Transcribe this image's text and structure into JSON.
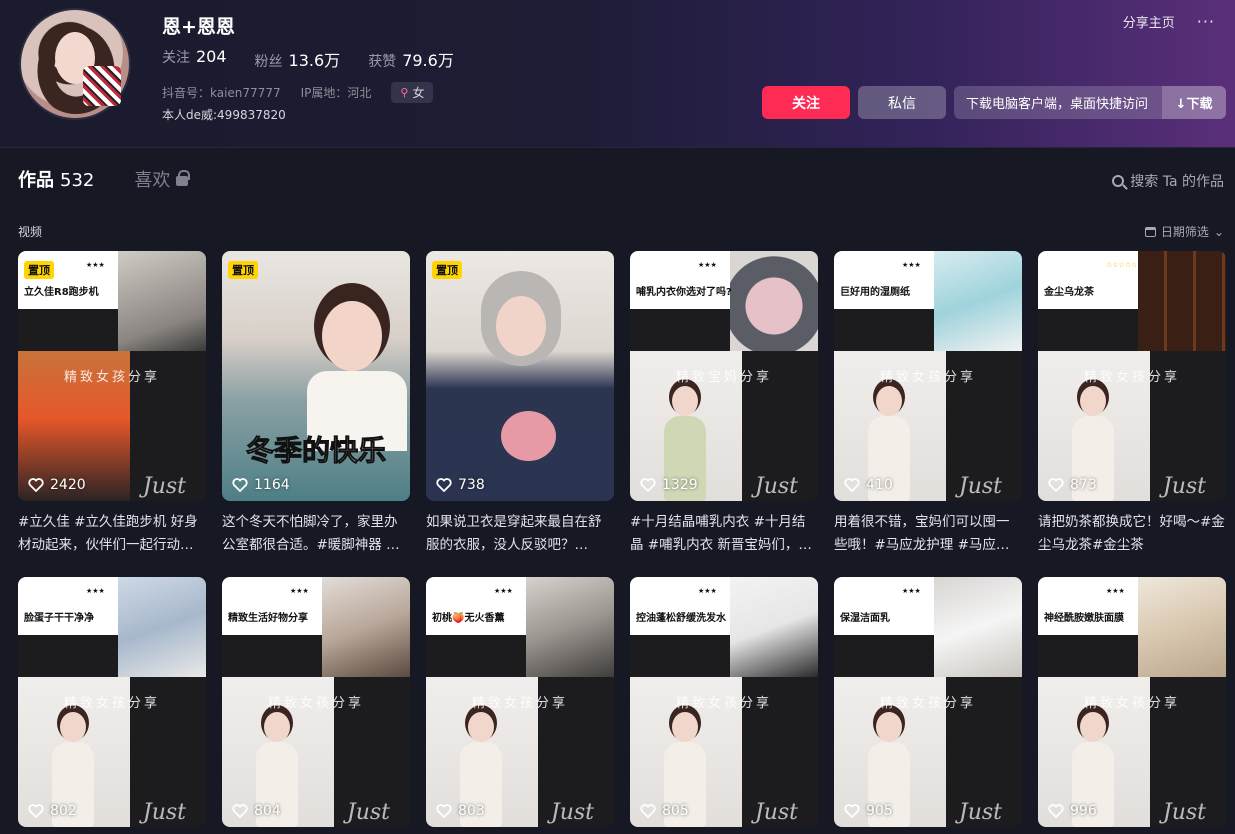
{
  "profile": {
    "name": "恩+恩恩",
    "following_label": "关注",
    "following": "204",
    "followers_label": "粉丝",
    "followers": "13.6万",
    "likes_label": "获赞",
    "likes": "79.6万",
    "douyin_id": "抖音号：kaien77777",
    "ip": "IP属地：河北",
    "gender": "女",
    "bio": "本人de威:499837820"
  },
  "topbar": {
    "share": "分享主页",
    "more": "···"
  },
  "actions": {
    "follow": "关注",
    "message": "私信",
    "download_text": "下载电脑客户端，桌面快捷访问",
    "download_btn": "↓下载"
  },
  "tabs": {
    "works_label": "作品",
    "works_count": "532",
    "likes_label": "喜欢"
  },
  "search": {
    "label": "搜索 Ta 的作品"
  },
  "section": {
    "label": "视频",
    "filter": "日期筛选"
  },
  "colors": {
    "accent": "#fe2c55",
    "bg": "#161823",
    "pin": "#ffd400"
  },
  "videos": [
    {
      "pinned": "置顶",
      "caption": "立久佳R8跑步机",
      "stars": "★★★",
      "watermark": "精致女孩分享",
      "likes": "2420",
      "desc": "#立久佳 #立久佳跑步机 好身材动起来，伙伴们一起行动…"
    },
    {
      "pinned": "置顶",
      "overlay": "冬季的快乐",
      "likes": "1164",
      "desc": "这个冬天不怕脚冷了，家里办公室都很合适。#暖脚神器 …"
    },
    {
      "pinned": "置顶",
      "likes": "738",
      "desc": "如果说卫衣是穿起来最自在舒服的衣服，没人反驳吧？…"
    },
    {
      "caption": "哺乳内衣你选对了吗?",
      "stars": "★★★",
      "watermark": "精致宝妈分享",
      "likes": "1329",
      "desc": "#十月结晶哺乳内衣 #十月结晶 #哺乳内衣 新晋宝妈们，…"
    },
    {
      "caption": "巨好用的湿厕纸",
      "stars": "★★★",
      "watermark": "精致女孩分享",
      "likes": "410",
      "desc": "用着很不错，宝妈们可以囤一些哦！#马应龙护理 #马应…"
    },
    {
      "caption": "金尘乌龙茶",
      "stars": "☆☆☆☆☆",
      "watermark": "精致女孩分享",
      "likes": "873",
      "desc": "请把奶茶都换成它！好喝～#金尘乌龙茶#金尘茶"
    },
    {
      "caption": "脸蛋子干干净净",
      "stars": "★★★",
      "watermark": "精致女孩分享",
      "likes": "802"
    },
    {
      "caption": "精致生活好物分享",
      "stars": "★★★",
      "watermark": "精致女孩分享",
      "likes": "804"
    },
    {
      "caption": "初桃🍑无火香薰",
      "stars": "★★★",
      "watermark": "精致女孩分享",
      "likes": "803"
    },
    {
      "caption": "控油蓬松舒缓洗发水",
      "stars": "★★★",
      "watermark": "精致女孩分享",
      "likes": "805"
    },
    {
      "caption": "保湿洁面乳",
      "stars": "★★★",
      "watermark": "精致女孩分享",
      "likes": "905"
    },
    {
      "caption": "神经酰胺嫩肤面膜",
      "stars": "★★★",
      "watermark": "精致女孩分享",
      "likes": "996"
    }
  ]
}
